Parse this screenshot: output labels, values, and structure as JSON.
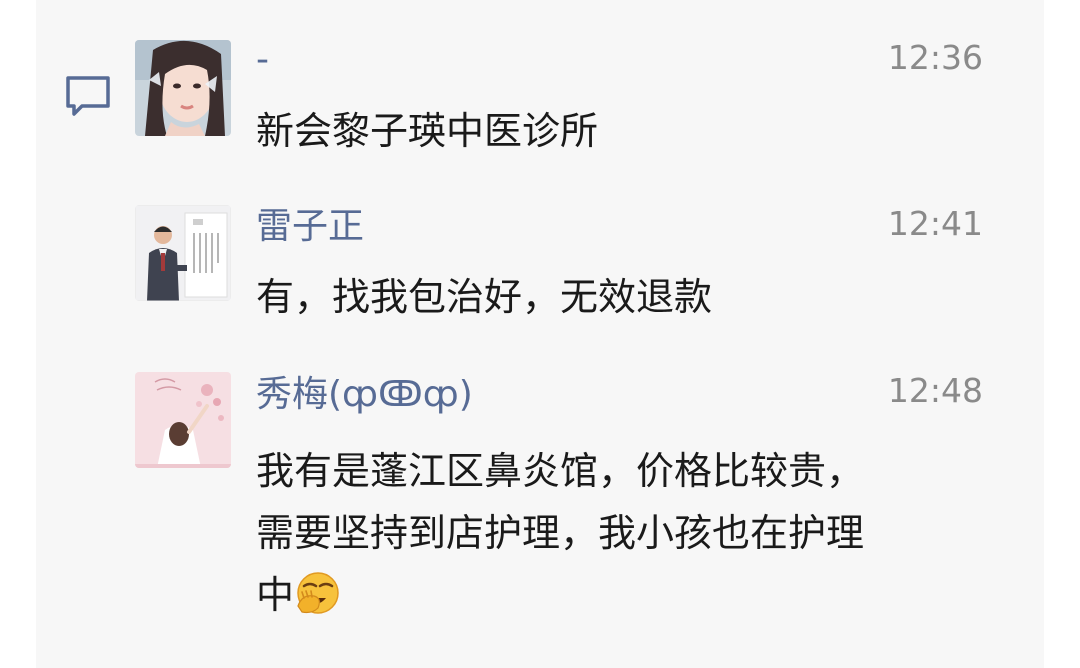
{
  "messages": [
    {
      "name": "-",
      "time": "12:36",
      "text": "新会黎子瑛中医诊所",
      "avatar": "avatar-woman-butterflies"
    },
    {
      "name": "雷子正",
      "time": "12:41",
      "text": "有，找我包治好，无效退款",
      "avatar": "avatar-man-in-suit"
    },
    {
      "name": "秀梅(ȹↂȹ)",
      "time": "12:48",
      "text": "我有是蓬江区鼻炎馆，价格比较贵，\n需要坚持到店护理，我小孩也在护理\n中",
      "trailing_emoji": "facepalm-emoji",
      "avatar": "avatar-pink-illustration"
    }
  ],
  "colors": {
    "panel_background": "#f7f7f7",
    "name_color": "#576b95",
    "time_color": "#8a8a8a",
    "text_color": "#1a1a1a"
  },
  "icons": {
    "comment": "comment-bubble-icon"
  }
}
